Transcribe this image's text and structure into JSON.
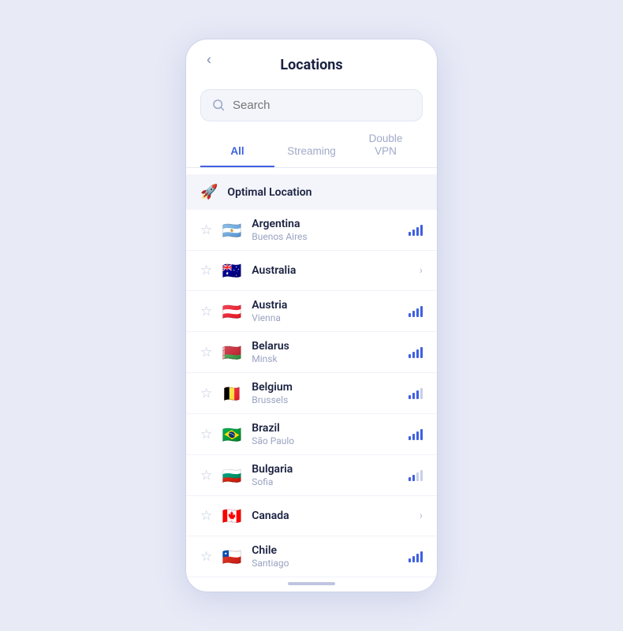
{
  "header": {
    "title": "Locations",
    "back_label": "‹"
  },
  "search": {
    "placeholder": "Search"
  },
  "tabs": [
    {
      "id": "all",
      "label": "All",
      "active": true
    },
    {
      "id": "streaming",
      "label": "Streaming",
      "active": false
    },
    {
      "id": "double-vpn",
      "label": "Double VPN",
      "active": false
    }
  ],
  "optimal": {
    "label": "Optimal Location",
    "icon": "🚀"
  },
  "locations": [
    {
      "name": "Argentina",
      "city": "Buenos Aires",
      "flag": "🇦🇷",
      "signal": "full",
      "has_children": false
    },
    {
      "name": "Australia",
      "city": "",
      "flag": "🇦🇺",
      "signal": "",
      "has_children": true
    },
    {
      "name": "Austria",
      "city": "Vienna",
      "flag": "🇦🇹",
      "signal": "full",
      "has_children": false
    },
    {
      "name": "Belarus",
      "city": "Minsk",
      "flag": "🇧🇾",
      "signal": "full",
      "has_children": false
    },
    {
      "name": "Belgium",
      "city": "Brussels",
      "flag": "🇧🇪",
      "signal": "med",
      "has_children": false
    },
    {
      "name": "Brazil",
      "city": "São Paulo",
      "flag": "🇧🇷",
      "signal": "full",
      "has_children": false
    },
    {
      "name": "Bulgaria",
      "city": "Sofia",
      "flag": "🇧🇬",
      "signal": "low",
      "has_children": false
    },
    {
      "name": "Canada",
      "city": "",
      "flag": "🇨🇦",
      "signal": "",
      "has_children": true
    },
    {
      "name": "Chile",
      "city": "Santiago",
      "flag": "🇨🇱",
      "signal": "full",
      "has_children": false
    }
  ]
}
